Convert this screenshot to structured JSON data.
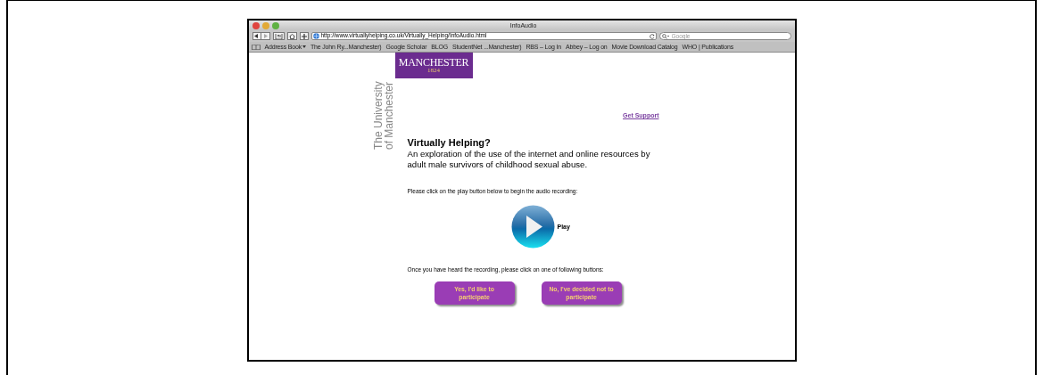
{
  "window": {
    "title": "InfoAudio"
  },
  "toolbar": {
    "url": "http://www.virtuallyhelping.co.uk/Virtually_Helping/InfoAudio.html",
    "search": {
      "placeholder": "Google"
    }
  },
  "bookmarks": [
    {
      "label": "Address Book",
      "kind": "menu"
    },
    {
      "label": "The John Ry...Manchester)",
      "kind": "link"
    },
    {
      "label": "Google Scholar",
      "kind": "link"
    },
    {
      "label": "BLOG",
      "kind": "link"
    },
    {
      "label": "StudentNet ...Manchester)",
      "kind": "link"
    },
    {
      "label": "RBS – Log In",
      "kind": "link"
    },
    {
      "label": "Abbey – Log on",
      "kind": "link"
    },
    {
      "label": "Movie Download Catalog",
      "kind": "link"
    },
    {
      "label": "WHO | Publications",
      "kind": "link"
    }
  ],
  "page": {
    "logo": {
      "name": "MANCHESTER",
      "year": "1824"
    },
    "side_text": "The University\nof Manchester",
    "support_link": "Get Support",
    "heading": "Virtually Helping?",
    "intro": "An exploration of the use of the internet and online resources by adult male survivors of childhood sexual abuse.",
    "play_prompt": "Please click on the play button below to begin the audio recording:",
    "play_label": "Play",
    "choice_prompt": "Once you have heard the recording, please click on one of following buttons:",
    "buttons": [
      {
        "label": "Yes, I'd like to participate"
      },
      {
        "label": "No, I've decided not to participate"
      }
    ]
  }
}
